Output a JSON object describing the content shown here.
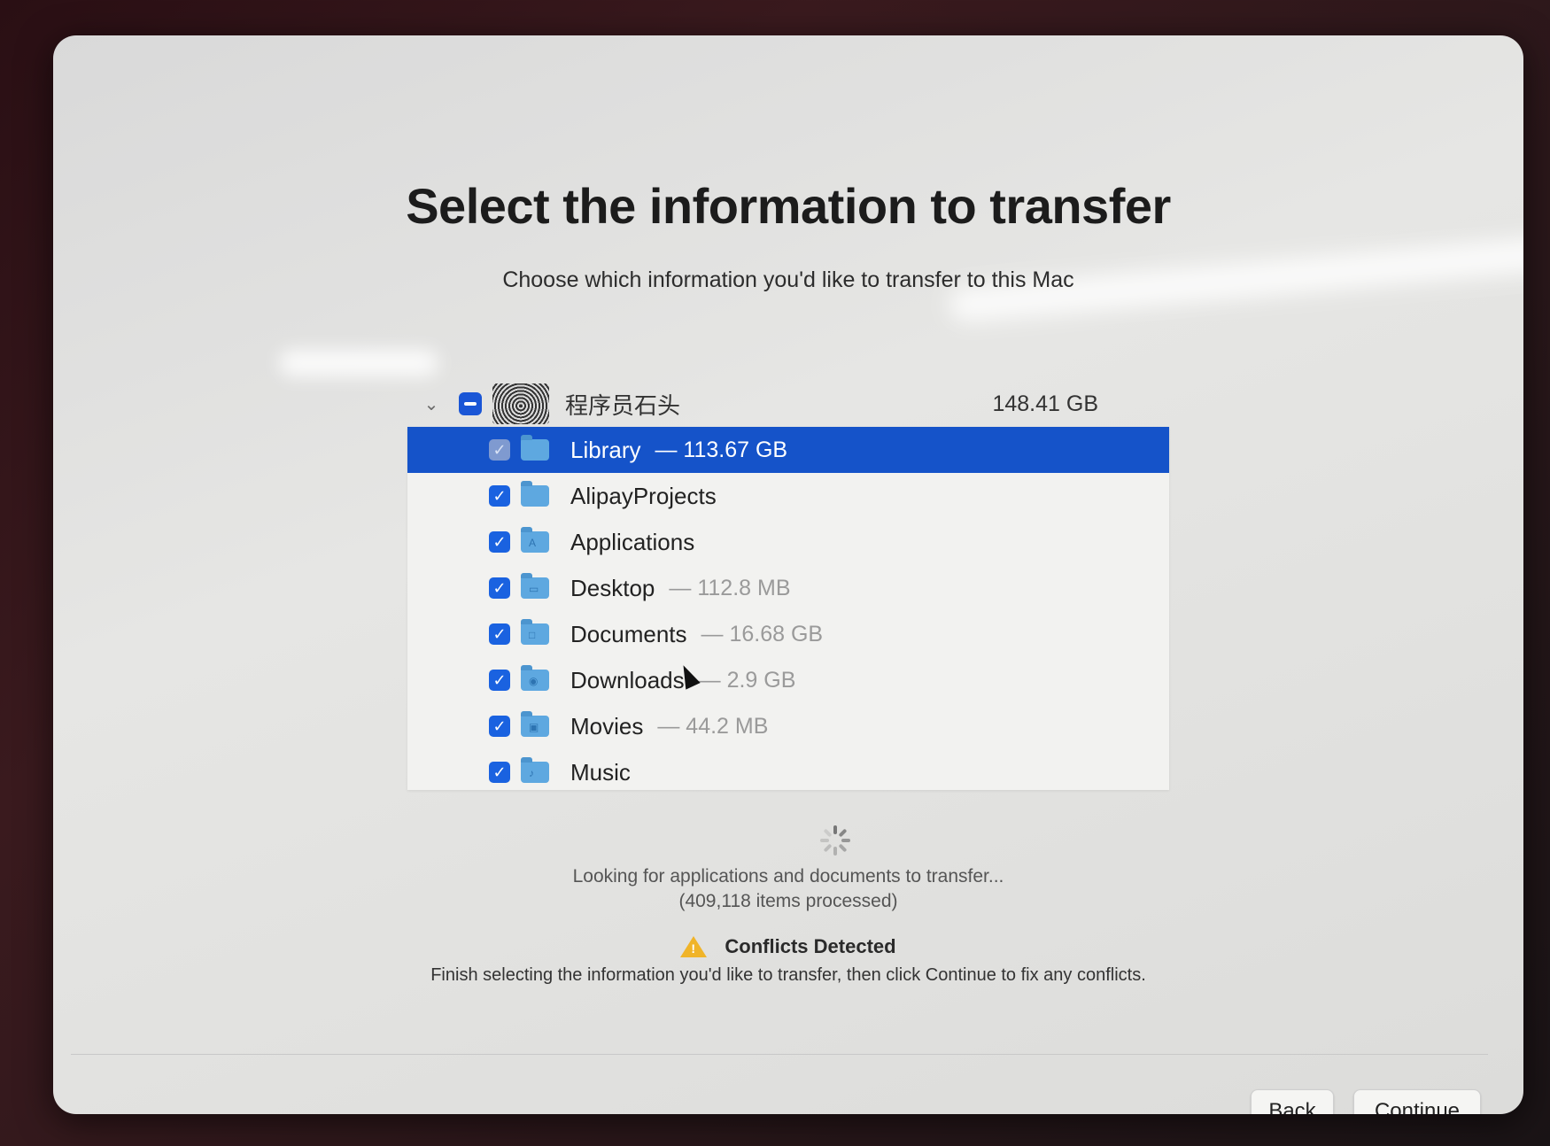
{
  "header": {
    "title": "Select the information to transfer",
    "subtitle": "Choose which information you'd like to transfer to this Mac"
  },
  "owner": {
    "name": "程序员石头",
    "size": "148.41 GB",
    "checkbox_state": "mixed"
  },
  "items": [
    {
      "label": "Library",
      "size": "— 113.67 GB",
      "checked": true,
      "selected": true
    },
    {
      "label": "AlipayProjects",
      "size": "",
      "checked": true,
      "selected": false
    },
    {
      "label": "Applications",
      "size": "",
      "checked": true,
      "selected": false
    },
    {
      "label": "Desktop",
      "size": "— 112.8 MB",
      "checked": true,
      "selected": false
    },
    {
      "label": "Documents",
      "size": "— 16.68 GB",
      "checked": true,
      "selected": false
    },
    {
      "label": "Downloads",
      "size": "— 2.9 GB",
      "checked": true,
      "selected": false
    },
    {
      "label": "Movies",
      "size": "— 44.2 MB",
      "checked": true,
      "selected": false
    },
    {
      "label": "Music",
      "size": "",
      "checked": true,
      "selected": false
    }
  ],
  "status": {
    "line1": "Looking for applications and documents to transfer...",
    "line2": "(409,118 items processed)"
  },
  "conflict": {
    "title": "Conflicts Detected",
    "message": "Finish selecting the information you'd like to transfer, then click Continue to fix any conflicts."
  },
  "buttons": {
    "back": "Back",
    "continue": "Continue"
  },
  "colors": {
    "selection": "#1553c9",
    "checkbox": "#1a62e0",
    "warning": "#f0b429"
  }
}
